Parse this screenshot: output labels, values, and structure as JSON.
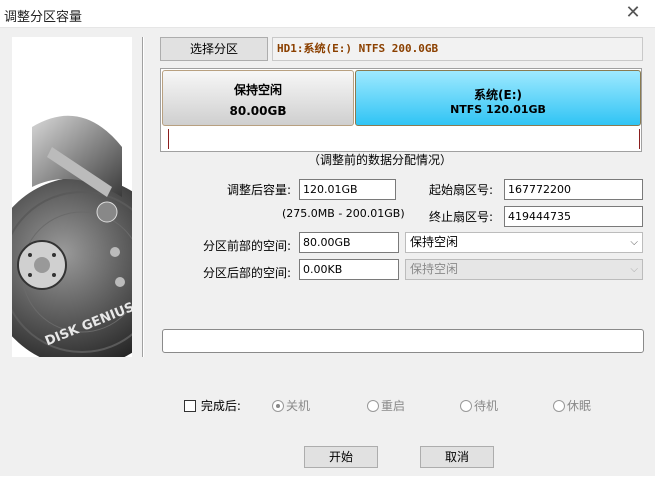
{
  "window": {
    "title": "调整分区容量"
  },
  "header": {
    "select_button": "选择分区",
    "partition_info": "HD1:系统(E:) NTFS 200.0GB"
  },
  "bar": {
    "free": {
      "name": "保持空闲",
      "size": "80.00GB"
    },
    "system": {
      "name": "系统(E:)",
      "detail": "NTFS 120.01GB"
    },
    "caption": "（调整前的数据分配情况）"
  },
  "form": {
    "size_label": "调整后容量:",
    "size_value": "120.01GB",
    "range": "(275.0MB - 200.01GB)",
    "start_label": "起始扇区号:",
    "start_value": "167772200",
    "end_label": "终止扇区号:",
    "end_value": "419444735",
    "front_label": "分区前部的空间:",
    "front_value": "80.00GB",
    "front_action": "保持空闲",
    "back_label": "分区后部的空间:",
    "back_value": "0.00KB",
    "back_action": "保持空闲"
  },
  "after": {
    "label": "完成后:",
    "options": [
      "关机",
      "重启",
      "待机",
      "休眠"
    ],
    "selected": "关机"
  },
  "buttons": {
    "start": "开始",
    "cancel": "取消"
  },
  "brand": {
    "logo_text": "DISK GENIUS"
  },
  "colors": {
    "system_partition": "#30c4f4",
    "partition_info_text": "#8b4000",
    "boundary_tick": "#8b1e1e"
  }
}
